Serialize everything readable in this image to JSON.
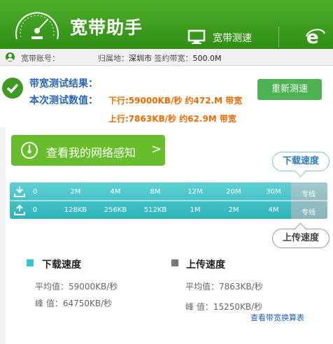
{
  "header": {
    "title": "宽带助手",
    "nav_label": "宽带测速",
    "colors": {
      "bg_top": "#4fae29",
      "bg_bottom": "#2f8e15"
    }
  },
  "account": {
    "account_label": "宽带账号：",
    "location_label": "归属地：",
    "location_value": "深圳市",
    "bandwidth_label": "签约带宽：",
    "bandwidth_value": "500.0M"
  },
  "result": {
    "title": "带宽测试结果：",
    "values_label": "本次测试数值：",
    "download_line": "下行:59000KB/秒 约472.M 带宽",
    "upload_line": "上行:7863KB/秒 约62.9M 带宽",
    "retest_button": "重新测速",
    "accent": "#f26b00"
  },
  "perception_button": {
    "label": "查看我的网络感知",
    "arrow": ">"
  },
  "bubbles": {
    "download": "下载速度",
    "upload": "上传速度"
  },
  "scale": {
    "download_ticks": [
      "0",
      "2M",
      "4M",
      "8M",
      "12M",
      "20M",
      "30M",
      "专线"
    ],
    "upload_ticks": [
      "0",
      "128KB",
      "256KB",
      "512KB",
      "1M",
      "2M",
      "4M",
      "专线"
    ],
    "colors": {
      "bar": "#2cb4ba",
      "dedicated": "#87b5b9"
    }
  },
  "stats": {
    "download": {
      "title": "下载速度",
      "avg": "平均值：59000KB/秒",
      "peak": "峰  值：64750KB/秒",
      "color": "#2ec7d3"
    },
    "upload": {
      "title": "上传速度",
      "avg": "平均值：7863KB/秒",
      "peak": "峰  值：15250KB/秒",
      "color": "#777777"
    }
  },
  "calc_link": "查看带宽换算表"
}
